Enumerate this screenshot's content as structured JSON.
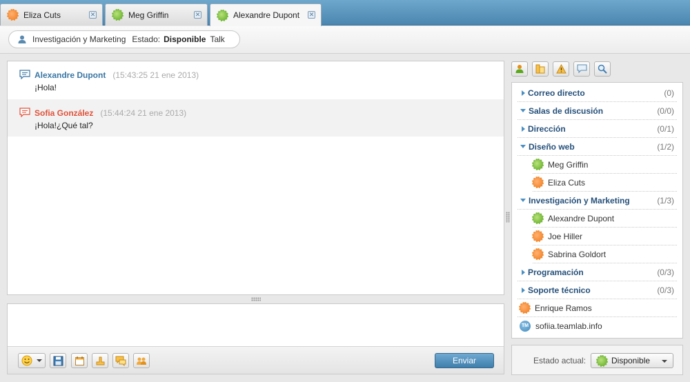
{
  "tabs": [
    {
      "name": "Eliza Cuts",
      "status": "away"
    },
    {
      "name": "Meg Griffin",
      "status": "online"
    },
    {
      "name": "Alexandre Dupont",
      "status": "online",
      "active": true
    }
  ],
  "info": {
    "department": "Investigación y Marketing",
    "state_label": "Estado:",
    "state_value": "Disponible",
    "client": "Talk"
  },
  "messages": [
    {
      "sender": "Alexandre Dupont",
      "time": "(15:43:25 21 ene 2013)",
      "text": "¡Hola!",
      "color": "#3a76a3"
    },
    {
      "sender": "Sofia González",
      "time": "(15:44:24 21 ene 2013)",
      "text": "¡Hola!¿Qué tal?",
      "color": "#e0523a"
    }
  ],
  "input": {
    "value": ""
  },
  "toolbar": {
    "icons": [
      "smiley-icon",
      "save-icon",
      "calendar-icon",
      "file-icon",
      "chat-history-icon",
      "group-icon"
    ],
    "send_label": "Enviar"
  },
  "sidebar_toolbar": {
    "icons": [
      "add-contact-icon",
      "groups-icon",
      "alert-icon",
      "chat-icon",
      "search-icon"
    ]
  },
  "contacts": {
    "groups": [
      {
        "name": "Correo directo",
        "count": "(0)",
        "expanded": false,
        "members": []
      },
      {
        "name": "Salas de discusión",
        "count": "(0/0)",
        "expanded": true,
        "members": []
      },
      {
        "name": "Dirección",
        "count": "(0/1)",
        "expanded": false,
        "members": []
      },
      {
        "name": "Diseño web",
        "count": "(1/2)",
        "expanded": true,
        "members": [
          {
            "name": "Meg Griffin",
            "status": "online"
          },
          {
            "name": "Eliza Cuts",
            "status": "away"
          }
        ]
      },
      {
        "name": "Investigación y Marketing",
        "count": "(1/3)",
        "expanded": true,
        "members": [
          {
            "name": "Alexandre Dupont",
            "status": "online"
          },
          {
            "name": "Joe Hiller",
            "status": "away"
          },
          {
            "name": "Sabrina Goldort",
            "status": "away"
          }
        ]
      },
      {
        "name": "Programación",
        "count": "(0/3)",
        "expanded": false,
        "members": []
      },
      {
        "name": "Soporte técnico",
        "count": "(0/3)",
        "expanded": false,
        "members": []
      }
    ],
    "ungrouped": [
      {
        "name": "Enrique Ramos",
        "status": "away"
      },
      {
        "name": "sofiia.teamlab.info",
        "status": "server",
        "badge": "TM"
      }
    ]
  },
  "status_select": {
    "label": "Estado actual:",
    "value": "Disponible"
  },
  "colors": {
    "tabbar": "#5a95bf",
    "online": "#5aa81e",
    "away": "#f07a1a",
    "group_text": "#25507a",
    "send_button": "#3f7eab"
  }
}
